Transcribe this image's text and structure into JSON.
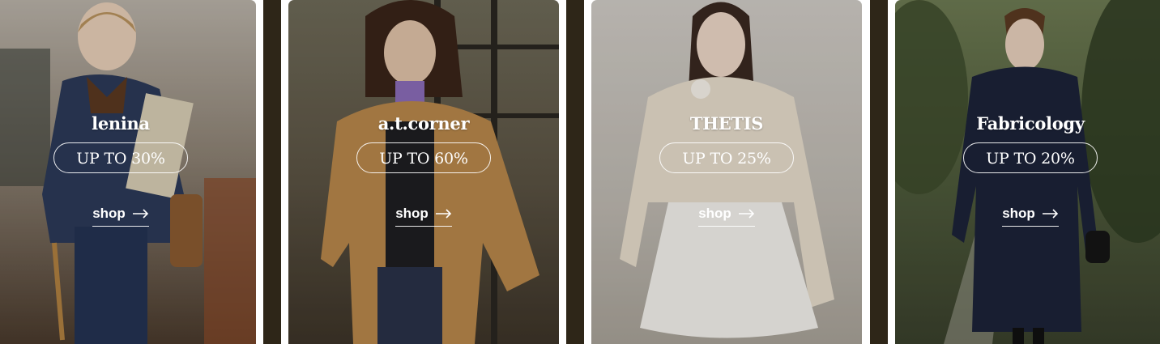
{
  "promos": [
    {
      "brand": "lenina",
      "discount": "UP TO 30%",
      "link_label": "shop",
      "link_icon": "arrow-right-icon",
      "bg_color": "#6e6559"
    },
    {
      "brand": "a.t.corner",
      "discount": "UP TO 60%",
      "link_label": "shop",
      "link_icon": "arrow-right-icon",
      "bg_color": "#6b5e45"
    },
    {
      "brand": "THETIS",
      "discount": "UP TO 25%",
      "link_label": "shop",
      "link_icon": "arrow-right-icon",
      "bg_color": "#bdb7ae"
    },
    {
      "brand": "Fabricology",
      "discount": "UP TO 20%",
      "link_label": "shop",
      "link_icon": "arrow-right-icon",
      "bg_color": "#4f5c3c"
    }
  ]
}
